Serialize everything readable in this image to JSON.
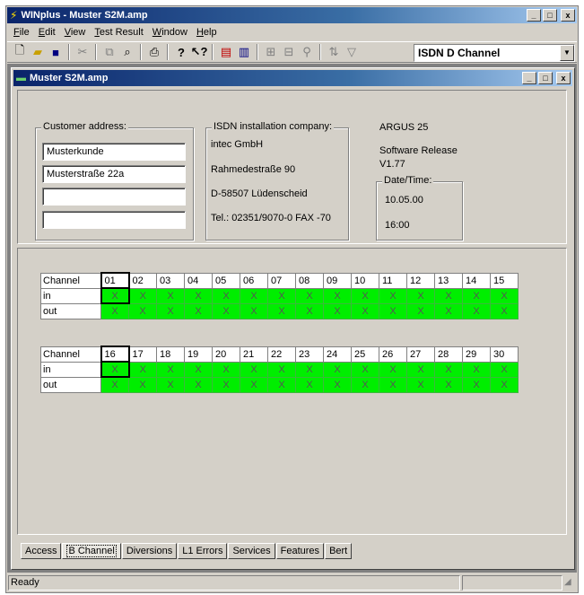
{
  "app": {
    "title": "WINplus - Muster S2M.amp",
    "window_buttons": [
      "_",
      "□",
      "x"
    ]
  },
  "menu": [
    "File",
    "Edit",
    "View",
    "Test Result",
    "Window",
    "Help"
  ],
  "toolbar": {
    "icons": [
      "new-icon",
      "open-icon",
      "save-icon",
      "cut-icon",
      "copy-icon",
      "find-icon",
      "print-icon",
      "help-icon",
      "context-help-icon",
      "export-icon",
      "import-icon",
      "zoom-in-icon",
      "zoom-out-icon",
      "magnify-icon",
      "sort-icon",
      "filter-icon"
    ],
    "channel_select": "ISDN D Channel"
  },
  "document": {
    "title": "Muster S2M.amp",
    "customer": {
      "legend": "Customer address:",
      "lines": [
        "Musterkunde",
        "Musterstraße 22a",
        "",
        ""
      ]
    },
    "installer": {
      "legend": "ISDN installation company:",
      "lines": [
        "intec GmbH",
        "Rahmedestraße 90",
        "D-58507 Lüdenscheid",
        "Tel.: 02351/9070-0 FAX -70"
      ]
    },
    "device": {
      "name": "ARGUS 25",
      "release_label": "Software Release",
      "release": "V1.77"
    },
    "datetime": {
      "legend": "Date/Time:",
      "date": "10.05.00",
      "time": "16:00"
    }
  },
  "channel_tables": [
    {
      "header": "Channel",
      "channels": [
        "01",
        "02",
        "03",
        "04",
        "05",
        "06",
        "07",
        "08",
        "09",
        "10",
        "11",
        "12",
        "13",
        "14",
        "15"
      ],
      "rows": [
        {
          "label": "in",
          "marks": [
            "X",
            "X",
            "X",
            "X",
            "X",
            "X",
            "X",
            "X",
            "X",
            "X",
            "X",
            "X",
            "X",
            "X",
            "X"
          ]
        },
        {
          "label": "out",
          "marks": [
            "X",
            "X",
            "X",
            "X",
            "X",
            "X",
            "X",
            "X",
            "X",
            "X",
            "X",
            "X",
            "X",
            "X",
            "X"
          ]
        }
      ]
    },
    {
      "header": "Channel",
      "channels": [
        "16",
        "17",
        "18",
        "19",
        "20",
        "21",
        "22",
        "23",
        "24",
        "25",
        "26",
        "27",
        "28",
        "29",
        "30"
      ],
      "rows": [
        {
          "label": "in",
          "marks": [
            "X",
            "X",
            "X",
            "X",
            "X",
            "X",
            "X",
            "X",
            "X",
            "X",
            "X",
            "X",
            "X",
            "X",
            "X"
          ]
        },
        {
          "label": "out",
          "marks": [
            "X",
            "X",
            "X",
            "X",
            "X",
            "X",
            "X",
            "X",
            "X",
            "X",
            "X",
            "X",
            "X",
            "X",
            "X"
          ]
        }
      ]
    }
  ],
  "tabs": [
    "Access",
    "B Channel",
    "Diversions",
    "L1 Errors",
    "Services",
    "Features",
    "Bert"
  ],
  "active_tab": "B Channel",
  "status": "Ready",
  "colors": {
    "active_cell": "#00ee00",
    "title_bar": "#0a246a",
    "face": "#d4d0c8"
  }
}
